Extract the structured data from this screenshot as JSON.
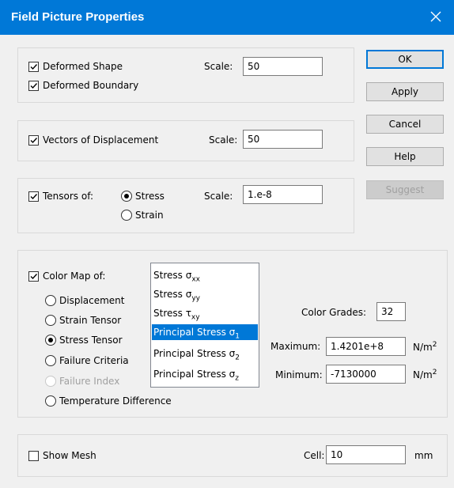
{
  "dialog": {
    "title": "Field Picture Properties"
  },
  "deformed": {
    "shape_label": "Deformed Shape",
    "shape_checked": true,
    "boundary_label": "Deformed Boundary",
    "boundary_checked": true,
    "scale_label": "Scale:",
    "scale_value": "50"
  },
  "vectors": {
    "label": "Vectors of Displacement",
    "checked": true,
    "scale_label": "Scale:",
    "scale_value": "50"
  },
  "tensors": {
    "label": "Tensors of:",
    "checked": true,
    "options": [
      "Stress",
      "Strain"
    ],
    "selected": "Stress",
    "scale_label": "Scale:",
    "scale_value": "1.e-8"
  },
  "colormap": {
    "label": "Color Map of:",
    "checked": true,
    "options": [
      {
        "label": "Displacement",
        "selected": false,
        "enabled": true
      },
      {
        "label": "Strain Tensor",
        "selected": false,
        "enabled": true
      },
      {
        "label": "Stress Tensor",
        "selected": true,
        "enabled": true
      },
      {
        "label": "Failure Criteria",
        "selected": false,
        "enabled": true
      },
      {
        "label": "Failure Index",
        "selected": false,
        "enabled": false
      },
      {
        "label": "Temperature Difference",
        "selected": false,
        "enabled": true
      }
    ],
    "list_items": [
      {
        "prefix": "Stress σ",
        "sub": "xx",
        "selected": false
      },
      {
        "prefix": "Stress σ",
        "sub": "yy",
        "selected": false
      },
      {
        "prefix": "Stress τ",
        "sub": "xy",
        "selected": false
      },
      {
        "prefix": "Principal Stress σ",
        "sub": "1",
        "selected": true
      },
      {
        "prefix": "Principal Stress σ",
        "sub": "2",
        "selected": false
      },
      {
        "prefix": "Principal Stress σ",
        "sub": "z",
        "selected": false
      }
    ],
    "grades_label": "Color Grades:",
    "grades_value": "32",
    "max_label": "Maximum:",
    "max_value": "1.4201e+8",
    "min_label": "Minimum:",
    "min_value": "-7130000",
    "unit_base": "N/m",
    "unit_exp": "2"
  },
  "mesh": {
    "label": "Show Mesh",
    "checked": false,
    "cell_label": "Cell:",
    "cell_value": "10",
    "cell_unit": "mm"
  },
  "buttons": {
    "ok": "OK",
    "apply": "Apply",
    "cancel": "Cancel",
    "help": "Help",
    "suggest": "Suggest"
  },
  "colors": {
    "accent": "#0078d7",
    "face": "#f0f0f0",
    "disabled": "#a0a0a0"
  },
  "icons": {
    "close": "close-icon",
    "check": "checkmark-icon"
  }
}
